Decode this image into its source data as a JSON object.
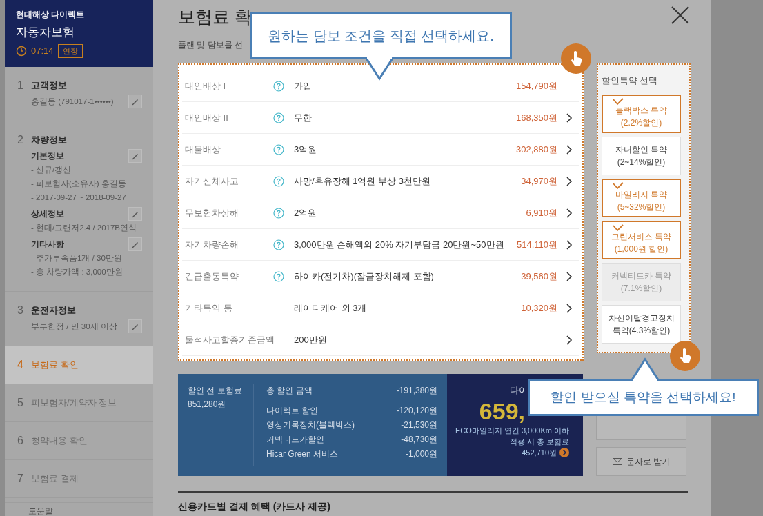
{
  "header": {
    "brand": "현대해상 다이렉트",
    "product": "자동차보험",
    "timer": "07:14",
    "extend_button": "연장"
  },
  "steps": [
    {
      "number": "1",
      "title": "고객정보",
      "selected": false,
      "done": true,
      "sections": [
        {
          "lines": [
            "홍길동 (791017-1••••••)"
          ],
          "editable": true
        }
      ]
    },
    {
      "number": "2",
      "title": "차량정보",
      "selected": false,
      "done": true,
      "sections": [
        {
          "heading": "기본정보",
          "editable": true,
          "lines": [
            "- 신규/갱신",
            "- 피보험자(소유자) 홍길동",
            "- 2017-09-27 ~ 2018-09-27"
          ]
        },
        {
          "heading": "상세정보",
          "editable": true,
          "lines": [
            "- 현대/그랜저2.4 / 2017B연식"
          ]
        },
        {
          "heading": "기타사항",
          "editable": true,
          "lines": [
            "- 추가부속품1개 / 30만원",
            "- 총 차량가액 : 3,000만원"
          ]
        }
      ]
    },
    {
      "number": "3",
      "title": "운전자정보",
      "selected": false,
      "done": true,
      "sections": [
        {
          "lines": [
            "부부한정 / 만 30세 이상"
          ],
          "editable": true
        }
      ]
    },
    {
      "number": "4",
      "title": "보험료 확인",
      "selected": true,
      "done": false
    },
    {
      "number": "5",
      "title": "피보험자/계약자 정보",
      "selected": false,
      "done": false
    },
    {
      "number": "6",
      "title": "청약내용 확인",
      "selected": false,
      "done": false
    },
    {
      "number": "7",
      "title": "보험료 결제",
      "selected": false,
      "done": false
    }
  ],
  "sidebar_buttons": [
    "도움말"
  ],
  "page": {
    "title": "보험료 확",
    "subtitle": "플랜 및 담보를 선"
  },
  "coverages": [
    {
      "label": "대인배상 I",
      "help": true,
      "value": "가입",
      "price": "154,790원",
      "chevron": false
    },
    {
      "label": "대인배상 II",
      "help": true,
      "value": "무한",
      "price": "168,350원",
      "chevron": true
    },
    {
      "label": "대물배상",
      "help": true,
      "value": "3억원",
      "price": "302,880원",
      "chevron": true
    },
    {
      "label": "자기신체사고",
      "help": true,
      "value": "사망/후유장해 1억원 부상 3천만원",
      "price": "34,970원",
      "chevron": true
    },
    {
      "label": "무보험차상해",
      "help": true,
      "value": "2억원",
      "price": "6,910원",
      "chevron": true
    },
    {
      "label": "자기차량손해",
      "help": true,
      "value": "3,000만원 손해액의 20% 자기부담금 20만원~50만원",
      "price": "514,110원",
      "chevron": true
    },
    {
      "label": "긴급출동특약",
      "help": true,
      "value": "하이카(전기차)(잠금장치해제 포함)",
      "price": "39,560원",
      "chevron": true
    },
    {
      "label": "기타특약 등",
      "help": false,
      "value": "레이디케어 외 3개",
      "price": "10,320원",
      "chevron": true
    },
    {
      "label": "물적사고할증기준금액",
      "help": false,
      "value": "200만원",
      "chevron": true
    }
  ],
  "discounts": {
    "title": "할인특약 선택",
    "items": [
      {
        "lines": [
          "블랙박스 특약",
          "(2.2%할인)"
        ],
        "selected": true,
        "disabled": false
      },
      {
        "lines": [
          "자녀할인 특약",
          "(2~14%할인)"
        ],
        "selected": false,
        "disabled": false
      },
      {
        "lines": [
          "마일리지 특약",
          "(5~32%할인)"
        ],
        "selected": true,
        "disabled": false
      },
      {
        "lines": [
          "그린서비스 특약",
          "(1,000원 할인)"
        ],
        "selected": true,
        "disabled": false
      },
      {
        "lines": [
          "커넥티드카 특약",
          "(7.1%할인)"
        ],
        "selected": false,
        "disabled": true
      },
      {
        "lines": [
          "차선이탈경고장치",
          "특약(4.3%할인)"
        ],
        "selected": false,
        "disabled": false
      }
    ]
  },
  "summary": {
    "before": {
      "label": "할인 전 보험료",
      "amount": "851,280원"
    },
    "total_discount": {
      "label": "총 할인 금액",
      "amount": "-191,380원"
    },
    "discount_lines": [
      {
        "label": "다이렉트 할인",
        "amount": "-120,120원"
      },
      {
        "label": "영상기록장치(블랙박스)",
        "amount": "-21,530원"
      },
      {
        "label": "커넥티드카할인",
        "amount": "-48,730원"
      },
      {
        "label": "Hicar Green 서비스",
        "amount": "-1,000원"
      }
    ],
    "final": {
      "label": "다이",
      "amount": "659,",
      "note_lines": [
        "ECO마일리지 연간 3,000Km 이하",
        "적용 시 총 보험료"
      ],
      "note_amount": "452,710원"
    }
  },
  "side_buttons": [
    {
      "kind": "covered"
    },
    {
      "kind": "mail",
      "label": "문자로 받기"
    }
  ],
  "card_benefits": {
    "title": "신용카드별 결제 혜택 (카드사 제공)"
  },
  "tips": [
    {
      "text": "원하는 담보 조건을 직접 선택하세요."
    },
    {
      "text": "할인 받으실 특약을 선택하세요!"
    }
  ]
}
